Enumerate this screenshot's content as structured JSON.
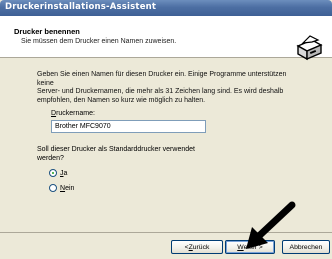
{
  "window": {
    "title": "Druckerinstallations-Assistent"
  },
  "header": {
    "title": "Drucker benennen",
    "subtitle": "Sie müssen dem Drucker einen Namen zuweisen.",
    "icon": "printer-icon"
  },
  "content": {
    "intro_lines": [
      "Geben Sie einen Namen für diesen Drucker ein. Einige Programme unterstützen keine",
      "Server- und Druckernamen, die mehr als 31 Zeichen lang sind. Es wird deshalb",
      "empfohlen, den Namen so kurz wie möglich zu halten."
    ],
    "printer_name_label_accel": "D",
    "printer_name_label_rest": "ruckername:",
    "printer_name_value": "Brother MFC9070",
    "default_question_lines": [
      "Soll dieser Drucker als Standarddrucker verwendet",
      "werden?"
    ],
    "options": [
      {
        "accel": "J",
        "rest": "a",
        "selected": true
      },
      {
        "accel": "N",
        "rest": "ein",
        "selected": false
      }
    ]
  },
  "buttons": {
    "back": {
      "prefix": "< ",
      "accel": "Z",
      "rest": "urück"
    },
    "next": {
      "accel": "W",
      "rest": "eiter >"
    },
    "cancel": "Abbrechen"
  },
  "colors": {
    "titlebar": "#4d6fa3",
    "dialog_bg": "#ece9d8",
    "button_border": "#003c74",
    "radio_dot": "#21a121"
  }
}
